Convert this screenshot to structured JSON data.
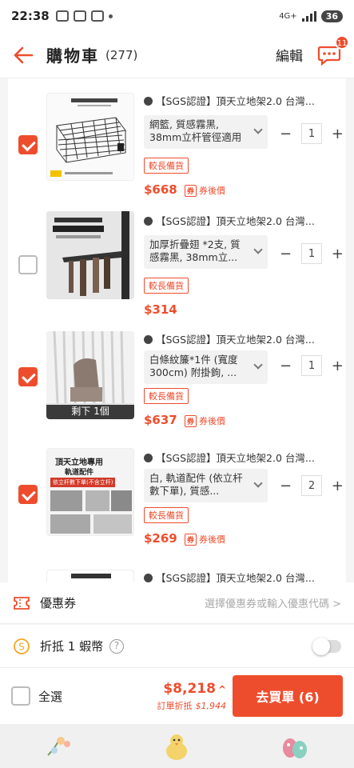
{
  "status": {
    "time": "22:38",
    "network": "4G+",
    "battery": "36"
  },
  "header": {
    "title": "購物車",
    "count": "(277)",
    "edit_label": "編輯",
    "chat_badge": "11"
  },
  "items": [
    {
      "checked": true,
      "title": "【SGS認證】頂天立地架2.0 台灣...",
      "variant": "網籃, 質感霧黑, 38mm立杆管徑適用",
      "qty": "1",
      "tag": "較長備貨",
      "price": "$668",
      "coupon": "券後價"
    },
    {
      "checked": false,
      "title": "【SGS認證】頂天立地架2.0 台灣...",
      "variant": "加厚折疊翅 *2支, 質感霧黑, 38mm立...",
      "qty": "1",
      "tag": "較長備貨",
      "price": "$314",
      "coupon": ""
    },
    {
      "checked": true,
      "title": "【SGS認證】頂天立地架2.0 台灣...",
      "variant": "白條紋簾*1件 (寬度300cm) 附掛鉤, ...",
      "qty": "1",
      "tag": "較長備貨",
      "price": "$637",
      "coupon": "券後價",
      "thumb_caption": "剩下 1個"
    },
    {
      "checked": true,
      "title": "【SGS認證】頂天立地架2.0 台灣...",
      "variant": "白, 軌道配件 (依立杆數下單), 質感...",
      "qty": "2",
      "tag": "較長備貨",
      "price": "$269",
      "coupon": "券後價",
      "thumb_text": "頂天立地專用",
      "thumb_sub": "軌道配件",
      "thumb_red": "依立杆數下單(不含立杆)"
    },
    {
      "checked": false,
      "title": "【SGS認證】頂天立地架2.0 台灣..."
    }
  ],
  "voucher": {
    "label": "優惠券",
    "hint": "選擇優惠券或輸入優惠代碼 >"
  },
  "coins": {
    "label": "折抵 1 蝦幣",
    "help": "?"
  },
  "checkout": {
    "select_all": "全選",
    "total": "$8,218",
    "saved_label": "訂單折抵",
    "saved_amount": "$1,944",
    "button": "去買單 (6)"
  },
  "colors": {
    "accent": "#ee4d2d"
  }
}
